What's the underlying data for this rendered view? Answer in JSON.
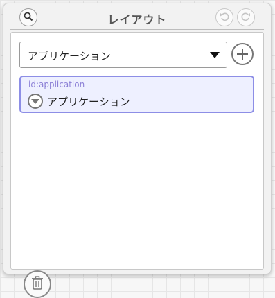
{
  "panel": {
    "title": "レイアウト"
  },
  "selector": {
    "value": "アプリケーション"
  },
  "tree": {
    "nodes": [
      {
        "id_label": "id:application",
        "label": "アプリケーション",
        "expanded": true
      }
    ]
  },
  "icons": {
    "search": "search-icon",
    "undo": "undo-icon",
    "redo": "redo-icon",
    "add": "plus-icon",
    "toggle": "chevron-down-icon",
    "delete": "trash-icon"
  },
  "colors": {
    "selected_node_border": "#8d8ee6",
    "selected_node_fill": "#eef0ff",
    "id_text": "#8b7fd6"
  }
}
